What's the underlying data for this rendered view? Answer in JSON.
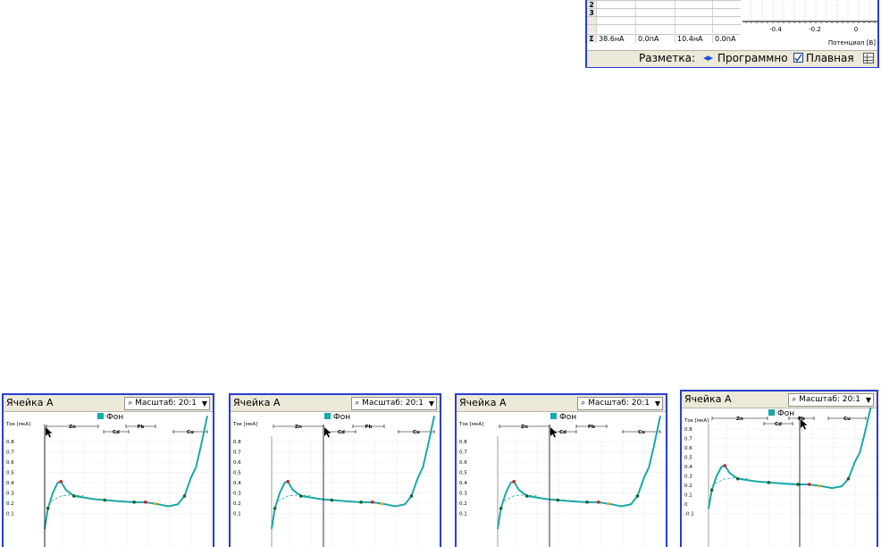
{
  "top_widget": {
    "table": {
      "rows": [
        {
          "label": "2",
          "cells": [
            "",
            "",
            "",
            ""
          ]
        },
        {
          "label": "3",
          "cells": [
            "",
            "",
            "",
            ""
          ]
        },
        {
          "label": "",
          "cells": [
            "",
            "",
            "",
            ""
          ]
        },
        {
          "label": "",
          "cells": [
            "",
            "",
            "",
            ""
          ]
        },
        {
          "label": "Σ",
          "cells": [
            "38.6нА",
            "0.0пА",
            "10.4нА",
            "0.0пА"
          ]
        }
      ]
    },
    "plot": {
      "x_ticks": [
        "-0.4",
        "-0.2",
        "0"
      ],
      "x_axis_label": "Потенциал [В]"
    },
    "toolbar": {
      "markup_label": "Разметка:",
      "mode_label": "Программно",
      "smooth_label": "Плавная",
      "smooth_checked": true
    }
  },
  "cell_windows": [
    {
      "title": "Ячейка А",
      "zoom": "Масштаб: 20:1",
      "cursor_pos": "Zn-start"
    },
    {
      "title": "Ячейка А",
      "zoom": "Масштаб: 20:1",
      "cursor_pos": "Zn-end"
    },
    {
      "title": "Ячейка А",
      "zoom": "Масштаб: 20:1",
      "cursor_pos": "Cd-start"
    },
    {
      "title": "Ячейка А",
      "zoom": "Масштаб: 20:1",
      "cursor_pos": "Pb-mid"
    }
  ],
  "plot_common": {
    "legend": "Фон",
    "ylabel": "Ток [мкА]",
    "y_ticks": [
      "0.8",
      "0.7",
      "0.6",
      "0.5",
      "0.4",
      "0.3",
      "0.2",
      "0.1"
    ],
    "y_ticks_last": [
      "0.8",
      "0.7",
      "0.6",
      "0.5",
      "0.4",
      "0.3",
      "0.2",
      "0.1",
      "0",
      "-0.1"
    ],
    "elements": [
      "Zn",
      "Cd",
      "Pb",
      "Cu"
    ]
  },
  "colors": {
    "curve": "#1aa8a8",
    "baseline": "#1aa8a8",
    "border": "#2a3fd0",
    "legend_swatch": "#1aa8a8",
    "peak_marker": "#d02020",
    "point_marker": "#1a6030"
  }
}
